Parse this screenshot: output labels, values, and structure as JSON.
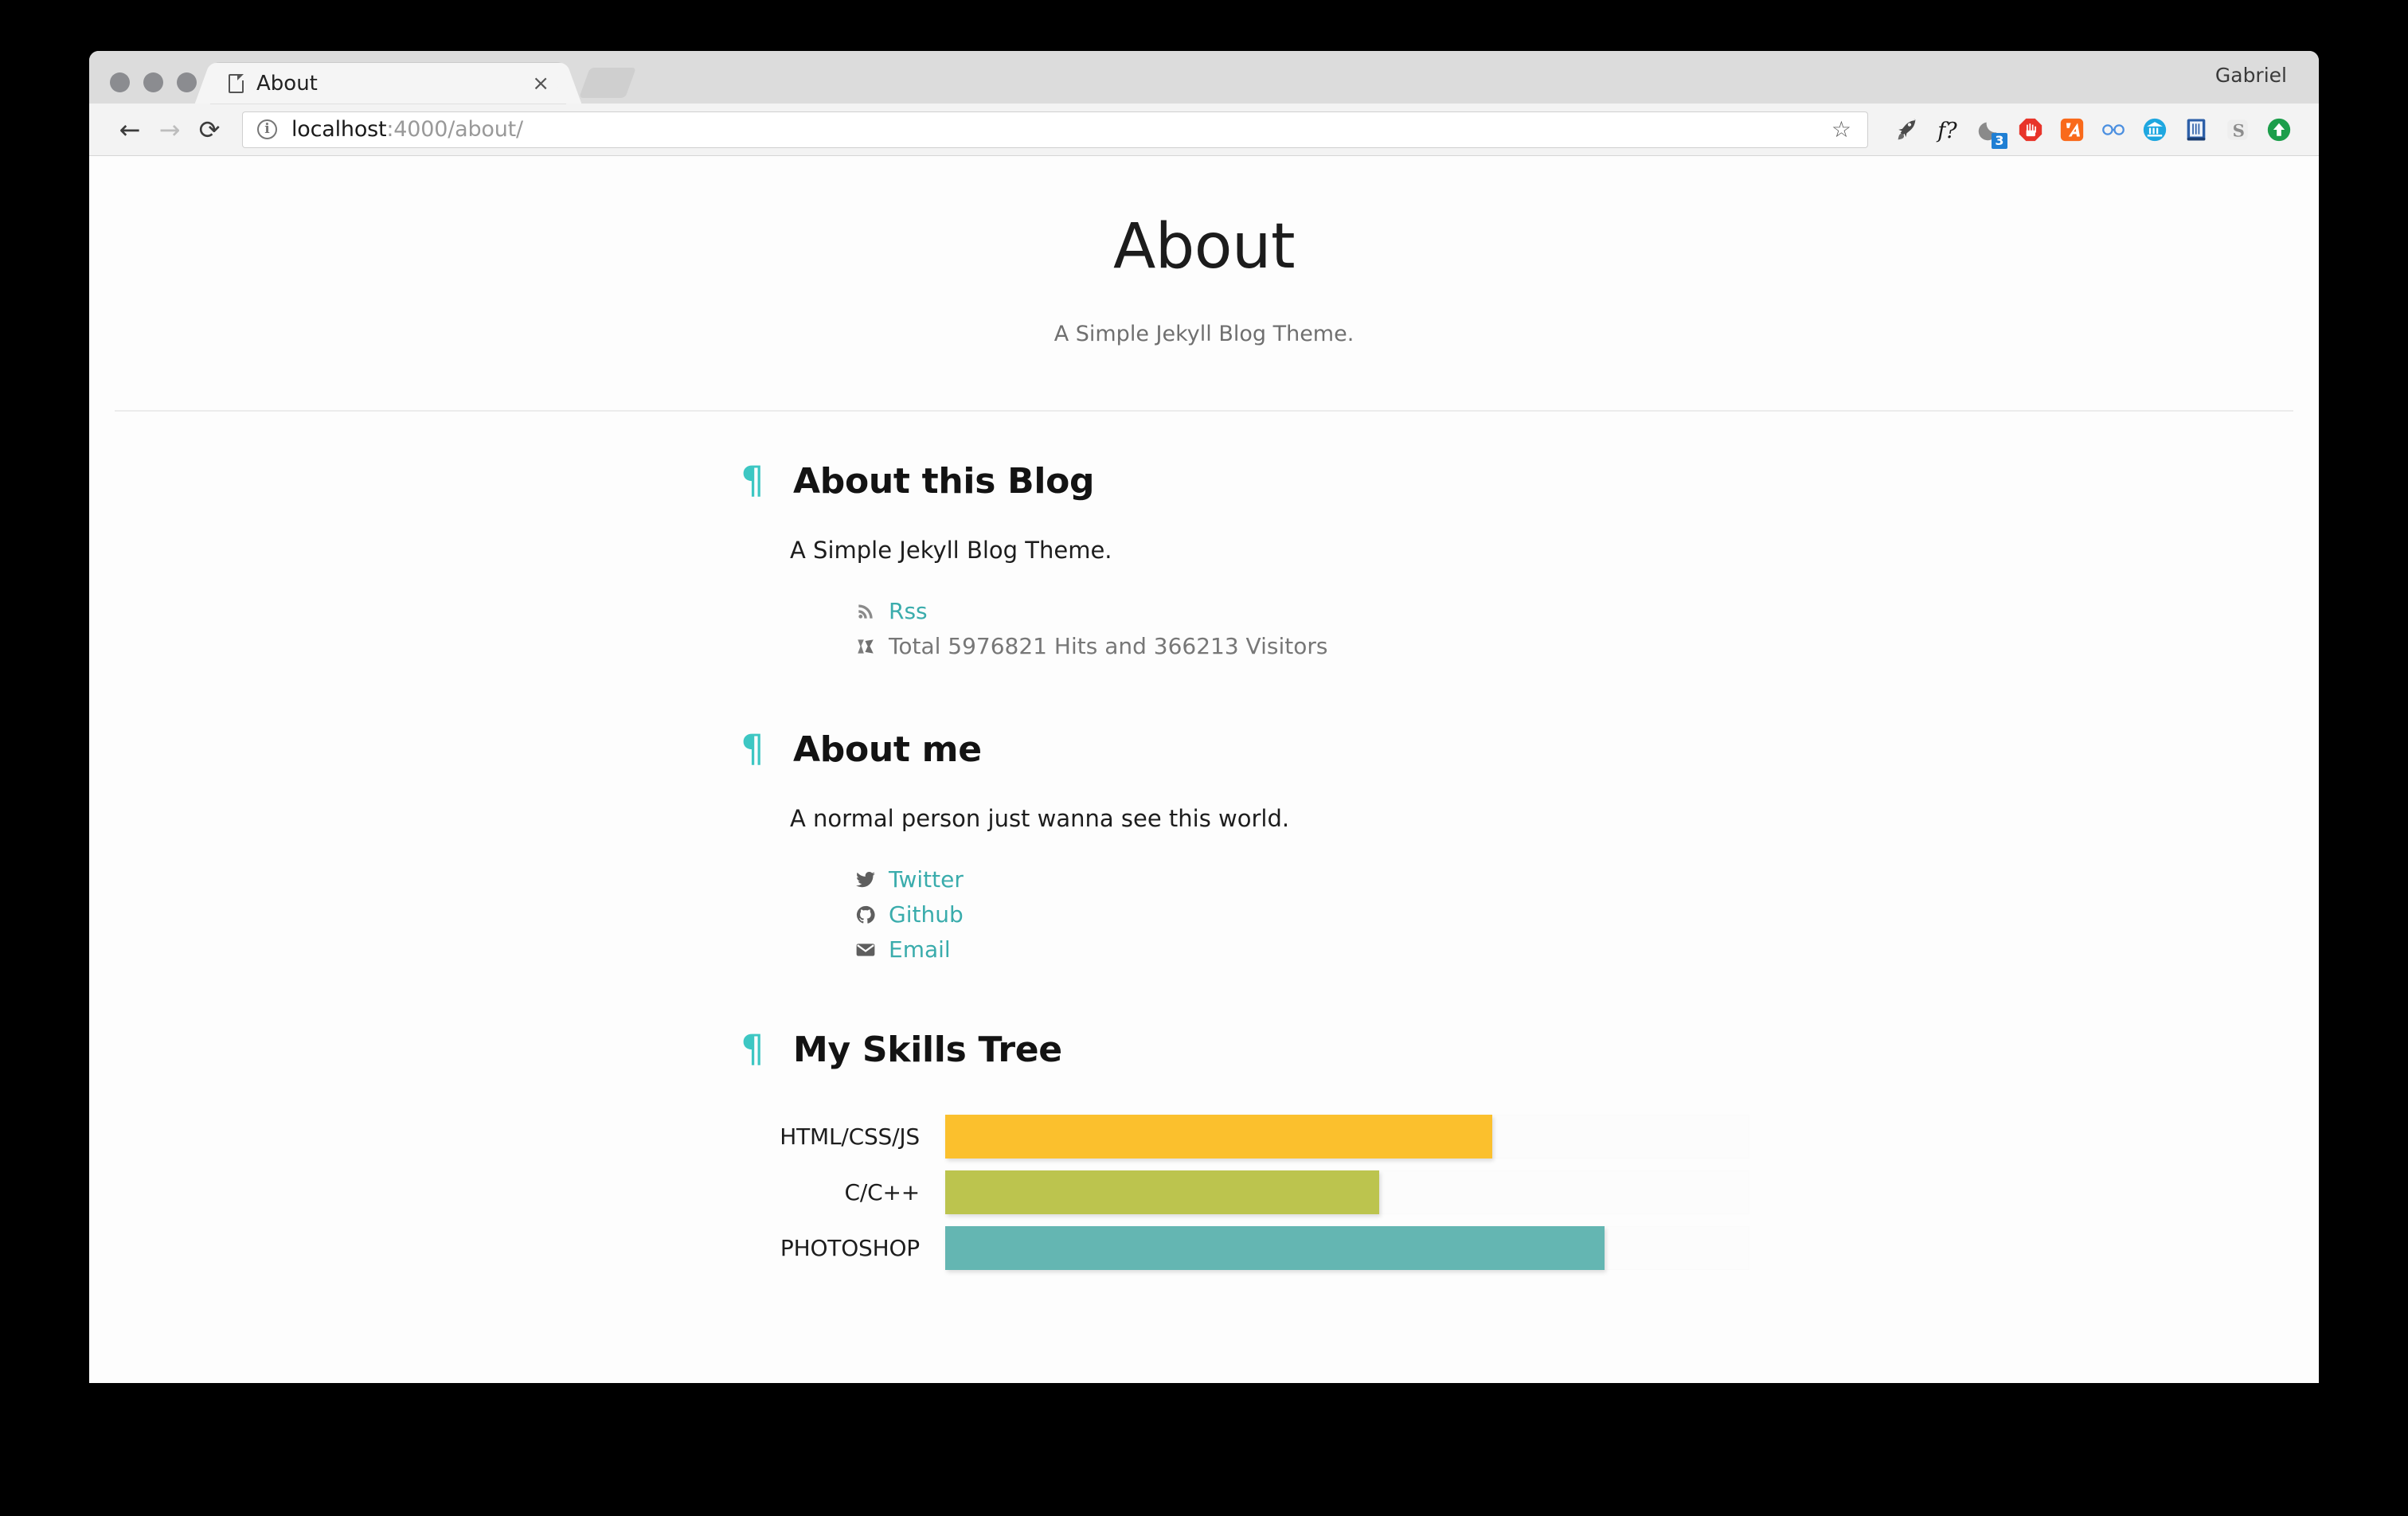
{
  "browser": {
    "tab": {
      "title": "About",
      "favicon": "document-icon",
      "close_label": "×"
    },
    "new_tab_label": "",
    "profile_name": "Gabriel",
    "nav": {
      "back": "←",
      "forward": "→",
      "reload": "⟳"
    },
    "omnibox": {
      "info_icon": "i",
      "url_host": "localhost",
      "url_rest": ":4000/about/",
      "bookmark_icon": "☆"
    },
    "extensions": [
      {
        "name": "rocket-icon",
        "label": ""
      },
      {
        "name": "function-question-icon",
        "label": "f?"
      },
      {
        "name": "moon-icon",
        "label": "",
        "badge": "3"
      },
      {
        "name": "stop-hand-icon",
        "label": ""
      },
      {
        "name": "orange-slash-icon",
        "label": ""
      },
      {
        "name": "glasses-icon",
        "label": ""
      },
      {
        "name": "bank-icon",
        "label": ""
      },
      {
        "name": "book-icon",
        "label": ""
      },
      {
        "name": "letter-s-icon",
        "label": "S"
      },
      {
        "name": "green-up-arrow-icon",
        "label": ""
      }
    ]
  },
  "page": {
    "title": "About",
    "subtitle": "A Simple Jekyll Blog Theme.",
    "sections": [
      {
        "pilcrow": "¶",
        "heading": "About this Blog",
        "body": "A Simple Jekyll Blog Theme.",
        "links": [
          {
            "icon": "rss-icon",
            "label": "Rss",
            "type": "link"
          },
          {
            "icon": "hits-counter-icon",
            "label": "Total 5976821 Hits and 366213 Visitors",
            "type": "static"
          }
        ]
      },
      {
        "pilcrow": "¶",
        "heading": "About me",
        "body": "A normal person just wanna see this world.",
        "links": [
          {
            "icon": "twitter-icon",
            "label": "Twitter",
            "type": "link"
          },
          {
            "icon": "github-icon",
            "label": "Github",
            "type": "link"
          },
          {
            "icon": "email-icon",
            "label": "Email",
            "type": "link"
          }
        ]
      },
      {
        "pilcrow": "¶",
        "heading": "My Skills Tree"
      }
    ]
  },
  "chart_data": {
    "type": "bar",
    "orientation": "horizontal",
    "title": "My Skills Tree",
    "categories": [
      "HTML/CSS/JS",
      "C/C++",
      "PHOTOSHOP"
    ],
    "values": [
      68,
      54,
      82
    ],
    "xlim": [
      0,
      100
    ],
    "ylabel": "",
    "xlabel": "",
    "grid": false,
    "legend": "none",
    "colors": [
      "#fbc02d",
      "#bcc44e",
      "#64b6b2"
    ],
    "track_color": "#fcfcfc"
  },
  "theme": {
    "accent": "#3dc7c3",
    "link": "#3aacac",
    "text": "#1d1d1d",
    "muted": "#777777"
  }
}
